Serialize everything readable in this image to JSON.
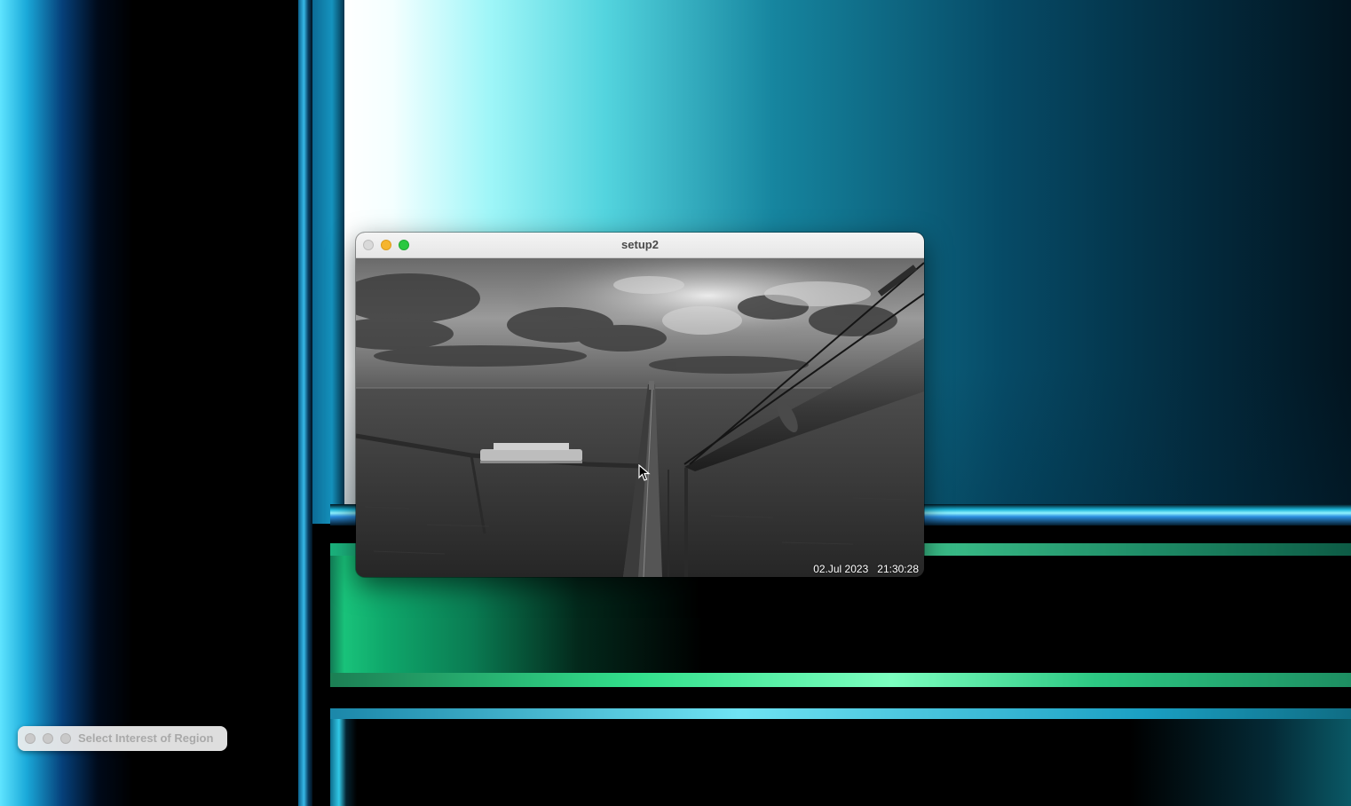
{
  "desktop": {
    "wallpaper": "blue-green-glass-panels"
  },
  "main_window": {
    "title": "setup2",
    "buttons": {
      "close": "close-button",
      "minimize": "minimize-button",
      "zoom": "zoom-button"
    },
    "overlay": {
      "date": "02.Jul 2023",
      "time": "21:30:28"
    }
  },
  "palette_window": {
    "title": "Select Interest of Region"
  },
  "colors": {
    "close_inactive": "#d9d9d9",
    "minimize": "#f5b52f",
    "zoom": "#2ac840",
    "accent_cyan": "#53d4de",
    "accent_green": "#32e08c"
  }
}
